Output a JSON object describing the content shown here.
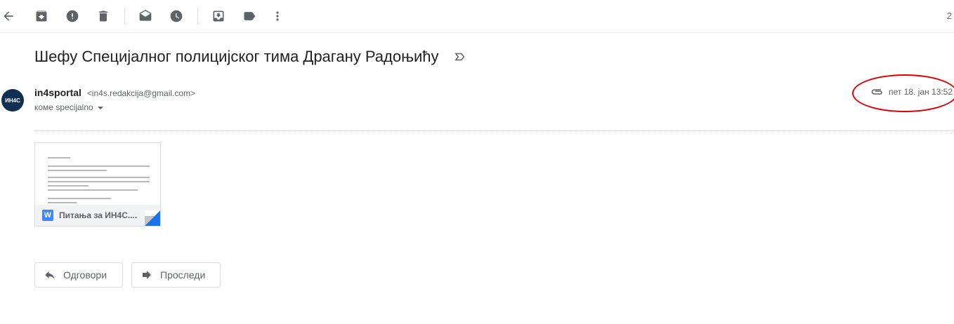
{
  "toolbar": {
    "icons": [
      "back-arrow-icon",
      "archive-icon",
      "report-spam-icon",
      "delete-icon",
      "mark-unread-icon",
      "snooze-icon",
      "move-to-icon",
      "label-icon",
      "more-vert-icon"
    ],
    "pager": "2"
  },
  "message": {
    "subject": "Шефу Специјалног полицијског тима Драгану Радоњићу",
    "sender_name": "in4sportal",
    "sender_email": "<in4s.redakcija@gmail.com>",
    "to_line": "коме specijalno",
    "date": "пет 18. јан 13:52",
    "avatar_text": "ИН4С"
  },
  "attachment": {
    "name": "Питања за ИН4С....",
    "type_letter": "W",
    "type_color": "#4285f4"
  },
  "actions": {
    "reply_label": "Одговори",
    "forward_label": "Проследи"
  },
  "colors": {
    "highlight_ellipse": "#e00000"
  }
}
